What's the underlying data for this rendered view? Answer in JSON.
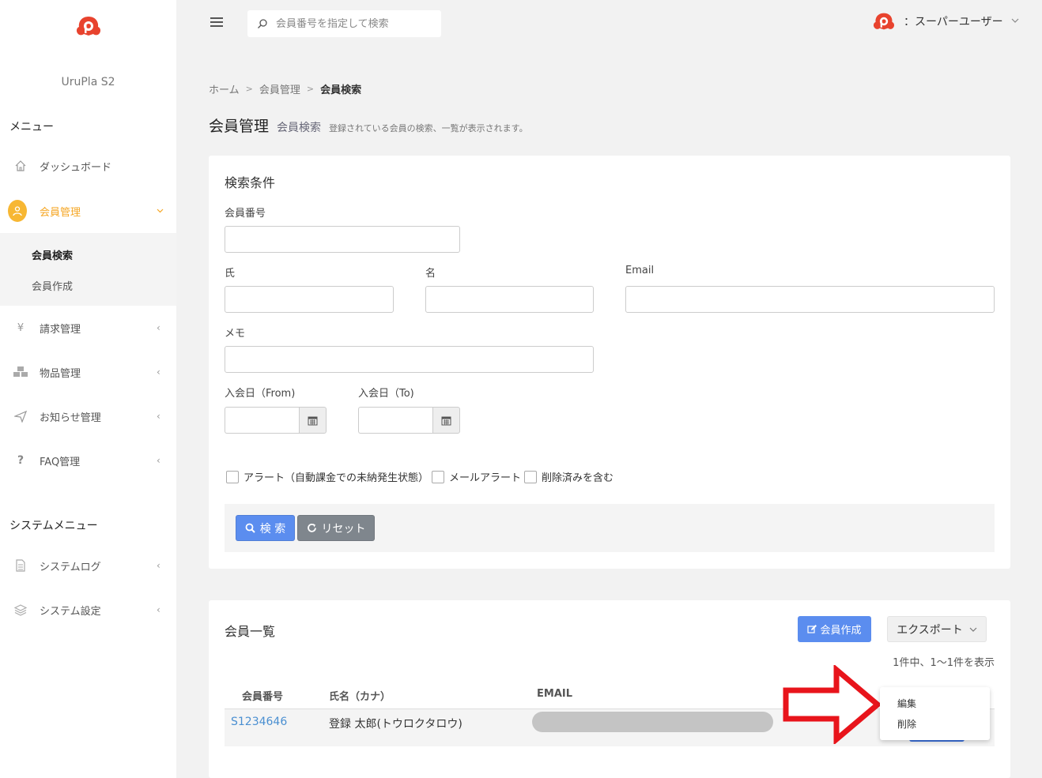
{
  "app": {
    "name": "UruPla S2"
  },
  "sidebar": {
    "menu_title": "メニュー",
    "system_title": "システムメニュー",
    "items": [
      {
        "label": "ダッシュボード",
        "icon": "home-icon"
      },
      {
        "label": "会員管理",
        "icon": "user-icon"
      },
      {
        "label": "請求管理",
        "icon": "yen-icon"
      },
      {
        "label": "物品管理",
        "icon": "cubes-icon"
      },
      {
        "label": "お知らせ管理",
        "icon": "paper-plane-icon"
      },
      {
        "label": "FAQ管理",
        "icon": "question-icon"
      }
    ],
    "sub_items": [
      {
        "label": "会員検索"
      },
      {
        "label": "会員作成"
      }
    ],
    "system_items": [
      {
        "label": "システムログ",
        "icon": "document-icon"
      },
      {
        "label": "システム設定",
        "icon": "layers-icon"
      }
    ]
  },
  "topbar": {
    "search_placeholder": "会員番号を指定して検索",
    "user_label": "：スーパーユーザー"
  },
  "breadcrumb": {
    "home": "ホーム",
    "level1": "会員管理",
    "current": "会員検索"
  },
  "page": {
    "title": "会員管理",
    "subtitle": "会員検索",
    "description": "登録されている会員の検索、一覧が表示されます。"
  },
  "search_form": {
    "title": "検索条件",
    "member_no_label": "会員番号",
    "last_name_label": "氏",
    "first_name_label": "名",
    "email_label": "Email",
    "memo_label": "メモ",
    "join_from_label": "入会日（From)",
    "join_to_label": "入会日（To)",
    "check_alert": "アラート（自動課金での未納発生状態）",
    "check_mail_alert": "メールアラート",
    "check_deleted": "削除済みを含む",
    "search_button": "検 索",
    "reset_button": "リセット"
  },
  "member_list": {
    "title": "会員一覧",
    "create_button": "会員作成",
    "export_button": "エクスポート",
    "count_text": "1件中、1〜1件を表示",
    "columns": [
      "会員番号",
      "氏名（カナ）",
      "EMAIL"
    ],
    "rows": [
      {
        "member_no": "S1234646",
        "name": "登録 太郎(トウロクタロウ)"
      }
    ],
    "dropdown": [
      "編集",
      "削除"
    ]
  },
  "colors": {
    "accent": "#f5a623",
    "primary": "#5b8def",
    "secondary": "#7f868d",
    "annotation_arrow": "#e8141b"
  }
}
